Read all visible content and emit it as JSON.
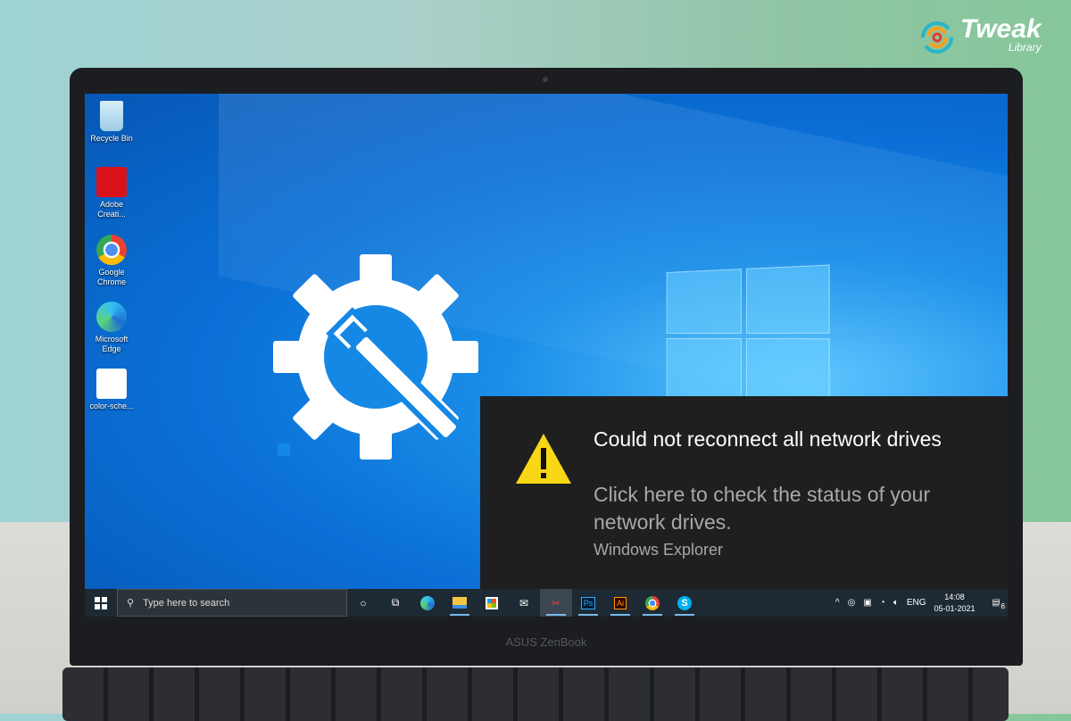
{
  "brand_logo": {
    "name": "Tweak",
    "sub": "Library"
  },
  "laptop_model": "ASUS ZenBook",
  "desktop_icons": [
    {
      "label": "Recycle Bin",
      "icon": "recycle-bin-icon"
    },
    {
      "label": "Adobe Creati...",
      "icon": "adobe-cc-icon"
    },
    {
      "label": "Google Chrome",
      "icon": "chrome-icon"
    },
    {
      "label": "Microsoft Edge",
      "icon": "edge-icon"
    },
    {
      "label": "color-sche...",
      "icon": "image-file-icon"
    }
  ],
  "notification": {
    "title": "Could not reconnect all network drives",
    "body": "Click here to check the status of your network drives.",
    "source": "Windows Explorer",
    "icon": "warning-icon"
  },
  "taskbar": {
    "search_placeholder": "Type here to search",
    "apps": [
      "cortana",
      "task-view",
      "edge",
      "file-explorer",
      "store",
      "mail",
      "snipping-tool",
      "photoshop",
      "illustrator",
      "chrome",
      "skype"
    ],
    "ps_label": "Ps",
    "ai_label": "Ai",
    "language": "ENG",
    "time": "14:08",
    "date": "05-01-2021",
    "notification_count": "6"
  },
  "colors": {
    "accent": "#0a78d7",
    "notification_bg": "#1f1f1f",
    "taskbar_bg": "#1e2a33",
    "warning": "#f7d716"
  }
}
